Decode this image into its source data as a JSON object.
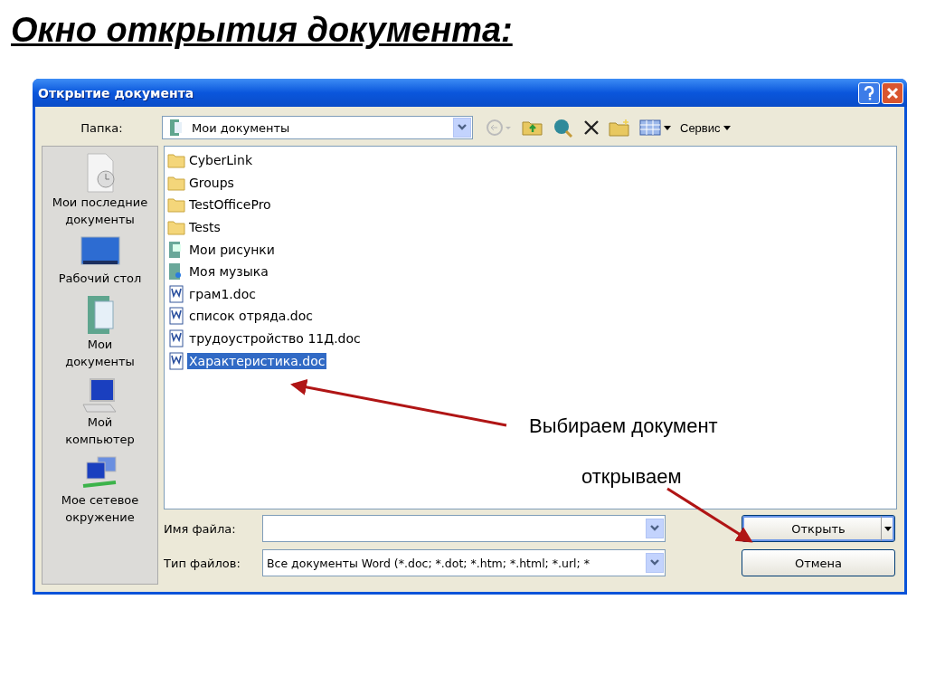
{
  "slide_title": "Окно открытия документа:",
  "window": {
    "title": "Открытие документа"
  },
  "folder": {
    "label": "Папка:",
    "value": "Мои документы"
  },
  "toolbar": {
    "service": "Сервис"
  },
  "places": [
    {
      "kind": "recent",
      "label": "Мои последние документы"
    },
    {
      "kind": "desktop",
      "label": "Рабочий стол"
    },
    {
      "kind": "documents",
      "label": "Мои документы"
    },
    {
      "kind": "computer",
      "label": "Мой компьютер"
    },
    {
      "kind": "network",
      "label": "Мое сетевое окружение"
    }
  ],
  "files": [
    {
      "kind": "folder",
      "name": "CyberLink",
      "selected": false
    },
    {
      "kind": "folder",
      "name": "Groups",
      "selected": false
    },
    {
      "kind": "folder",
      "name": "TestOfficePro",
      "selected": false
    },
    {
      "kind": "folder",
      "name": "Tests",
      "selected": false
    },
    {
      "kind": "pictures",
      "name": "Мои рисунки",
      "selected": false
    },
    {
      "kind": "music",
      "name": "Моя музыка",
      "selected": false
    },
    {
      "kind": "doc",
      "name": "грам1.doc",
      "selected": false
    },
    {
      "kind": "doc",
      "name": "список отряда.doc",
      "selected": false
    },
    {
      "kind": "doc",
      "name": "трудоустройство 11Д.doc",
      "selected": false
    },
    {
      "kind": "doc",
      "name": "Характеристика.doc",
      "selected": true
    }
  ],
  "file_name": {
    "label": "Имя файла:"
  },
  "file_type": {
    "label": "Тип файлов:",
    "value": "Все документы Word (*.doc; *.dot; *.htm; *.html; *.url; *"
  },
  "buttons": {
    "open": "Открыть",
    "cancel": "Отмена"
  },
  "annotations": [
    {
      "text": "Выбираем документ"
    },
    {
      "text": "открываем"
    }
  ]
}
